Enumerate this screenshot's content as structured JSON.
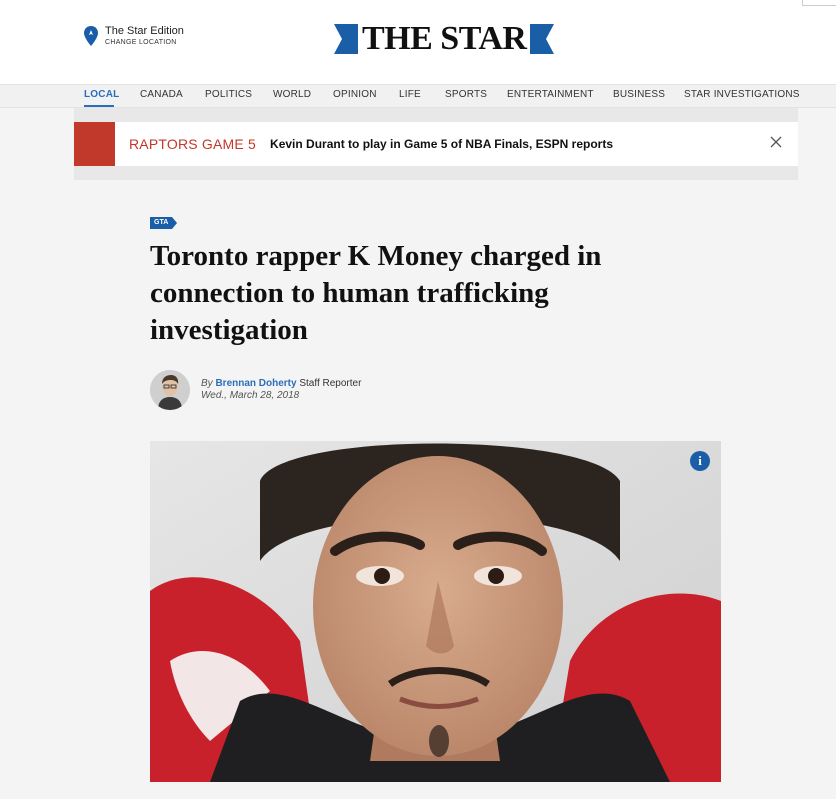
{
  "header": {
    "edition_title": "The Star Edition",
    "edition_change": "CHANGE LOCATION",
    "logo_text": "THE STAR",
    "brand_color": "#1a5ea8"
  },
  "nav": {
    "items": [
      "LOCAL",
      "CANADA",
      "POLITICS",
      "WORLD",
      "OPINION",
      "LIFE",
      "SPORTS",
      "ENTERTAINMENT",
      "BUSINESS",
      "STAR INVESTIGATIONS"
    ],
    "active": "LOCAL"
  },
  "breaking": {
    "tag": "RAPTORS GAME 5",
    "headline": "Kevin Durant to play in Game 5 of NBA Finals, ESPN reports",
    "accent_color": "#c0392b",
    "close_icon": "close-icon"
  },
  "article": {
    "section": "GTA",
    "title": "Toronto rapper K Money charged in connection to human trafficking investigation",
    "byline_prefix": "By",
    "author": "Brennan Doherty",
    "author_role": "Staff Reporter",
    "date": "Wed., March 28, 2018",
    "photo_info_icon": "info-icon",
    "info_label": "i"
  }
}
